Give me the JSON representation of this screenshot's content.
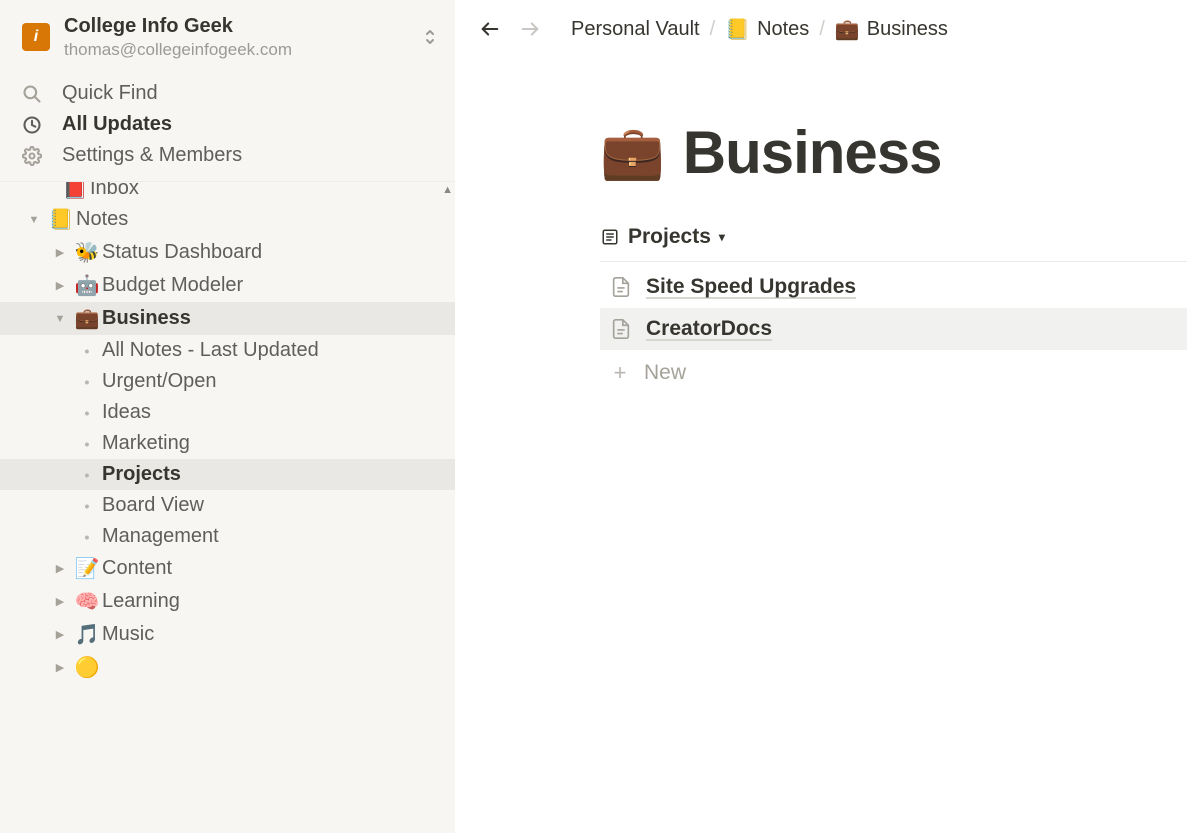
{
  "workspace": {
    "title": "College Info Geek",
    "email": "thomas@collegeinfogeek.com",
    "logo_text": "i"
  },
  "top_nav": {
    "quick_find": "Quick Find",
    "all_updates": "All Updates",
    "settings": "Settings & Members"
  },
  "tree": {
    "inbox_partial_label": "Inbox",
    "inbox_partial_emoji": "📕",
    "notes": {
      "emoji": "📒",
      "label": "Notes"
    },
    "status_dashboard": {
      "emoji": "🐝",
      "label": "Status Dashboard"
    },
    "budget_modeler": {
      "emoji": "🤖",
      "label": "Budget Modeler"
    },
    "business": {
      "emoji": "💼",
      "label": "Business"
    },
    "business_children": {
      "all_notes": "All Notes - Last Updated",
      "urgent": "Urgent/Open",
      "ideas": "Ideas",
      "marketing": "Marketing",
      "projects": "Projects",
      "board_view": "Board View",
      "management": "Management"
    },
    "content": {
      "emoji": "📝",
      "label": "Content"
    },
    "learning": {
      "emoji": "🧠",
      "label": "Learning"
    },
    "music": {
      "emoji": "🎵",
      "label": "Music"
    }
  },
  "breadcrumb": {
    "personal_vault": "Personal Vault",
    "notes": {
      "emoji": "📒",
      "label": "Notes"
    },
    "business": {
      "emoji": "💼",
      "label": "Business"
    }
  },
  "page": {
    "icon": "💼",
    "title": "Business",
    "view_label": "Projects",
    "items": {
      "site_speed": "Site Speed Upgrades",
      "creator_docs": "CreatorDocs"
    },
    "new_label": "New"
  }
}
